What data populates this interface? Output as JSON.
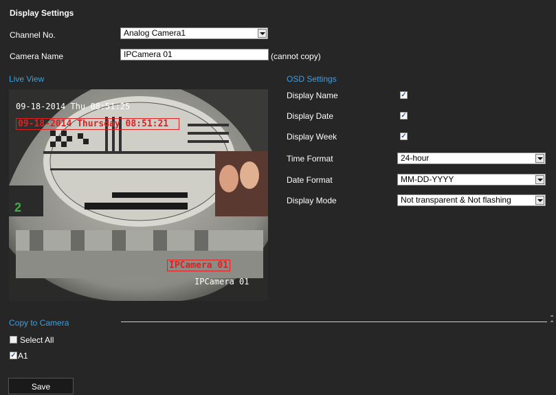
{
  "header": {
    "title": "Display Settings"
  },
  "form": {
    "channel_label": "Channel No.",
    "channel_value": "Analog Camera1",
    "camera_name_label": "Camera Name",
    "camera_name_value": "IPCamera 01",
    "cannot_copy": "(cannot copy)"
  },
  "live_view": {
    "title": "Live View",
    "osd_date_white": "09-18-2014 Thu 08:51:25",
    "osd_date_red": "09-18-2014 Thursday 08:51:21",
    "osd_name_red": "IPCamera 01",
    "osd_name_white": "IPCamera 01"
  },
  "osd": {
    "title": "OSD Settings",
    "display_name_label": "Display Name",
    "display_name_checked": true,
    "display_date_label": "Display Date",
    "display_date_checked": true,
    "display_week_label": "Display Week",
    "display_week_checked": true,
    "time_format_label": "Time Format",
    "time_format_value": "24-hour",
    "date_format_label": "Date Format",
    "date_format_value": "MM-DD-YYYY",
    "display_mode_label": "Display Mode",
    "display_mode_value": "Not transparent & Not flashing"
  },
  "copy": {
    "title": "Copy to Camera",
    "select_all_label": "Select All",
    "select_all_checked": false,
    "a1_label": "A1",
    "a1_checked": true,
    "collapse_icon": "chevron-up-double-icon"
  },
  "actions": {
    "save_label": "Save"
  },
  "colors": {
    "accent": "#3ea0e0",
    "osd_red": "#e02020",
    "background": "#262626"
  }
}
